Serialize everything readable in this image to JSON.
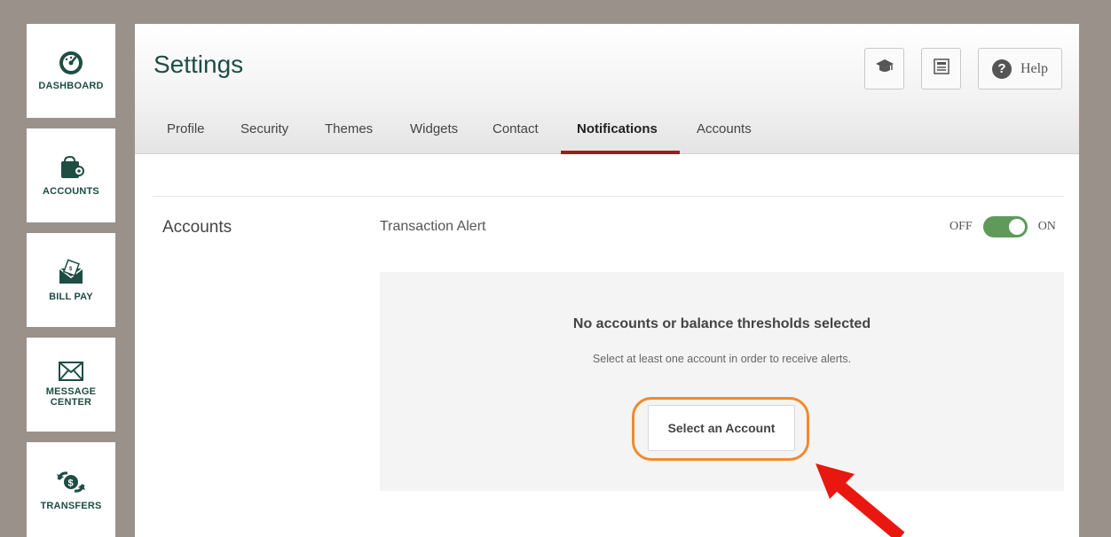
{
  "sidebar": {
    "items": [
      {
        "label": "DASHBOARD",
        "icon": "speedometer-icon"
      },
      {
        "label": "ACCOUNTS",
        "icon": "wallet-icon"
      },
      {
        "label": "BILL PAY",
        "icon": "envelope-bill-icon"
      },
      {
        "label": "MESSAGE CENTER",
        "icon": "mail-icon"
      },
      {
        "label": "TRANSFERS",
        "icon": "money-transfer-icon"
      }
    ]
  },
  "header": {
    "title": "Settings",
    "help_label": "Help",
    "tabs": [
      "Profile",
      "Security",
      "Themes",
      "Widgets",
      "Contact",
      "Notifications",
      "Accounts"
    ],
    "active_tab": "Notifications"
  },
  "content": {
    "section_label": "Accounts",
    "alert_label": "Transaction Alert",
    "toggle": {
      "off_label": "OFF",
      "on_label": "ON",
      "state": "on"
    },
    "empty_state": {
      "title": "No accounts or balance thresholds selected",
      "subtitle": "Select at least one account in order to receive alerts.",
      "button_label": "Select an Account"
    }
  },
  "colors": {
    "brand_green": "#1e4d43",
    "toggle_green": "#5f9a5b",
    "active_tab_underline": "#9c1c1f",
    "highlight_orange": "#f08a2c",
    "arrow_red": "#e8170f"
  }
}
